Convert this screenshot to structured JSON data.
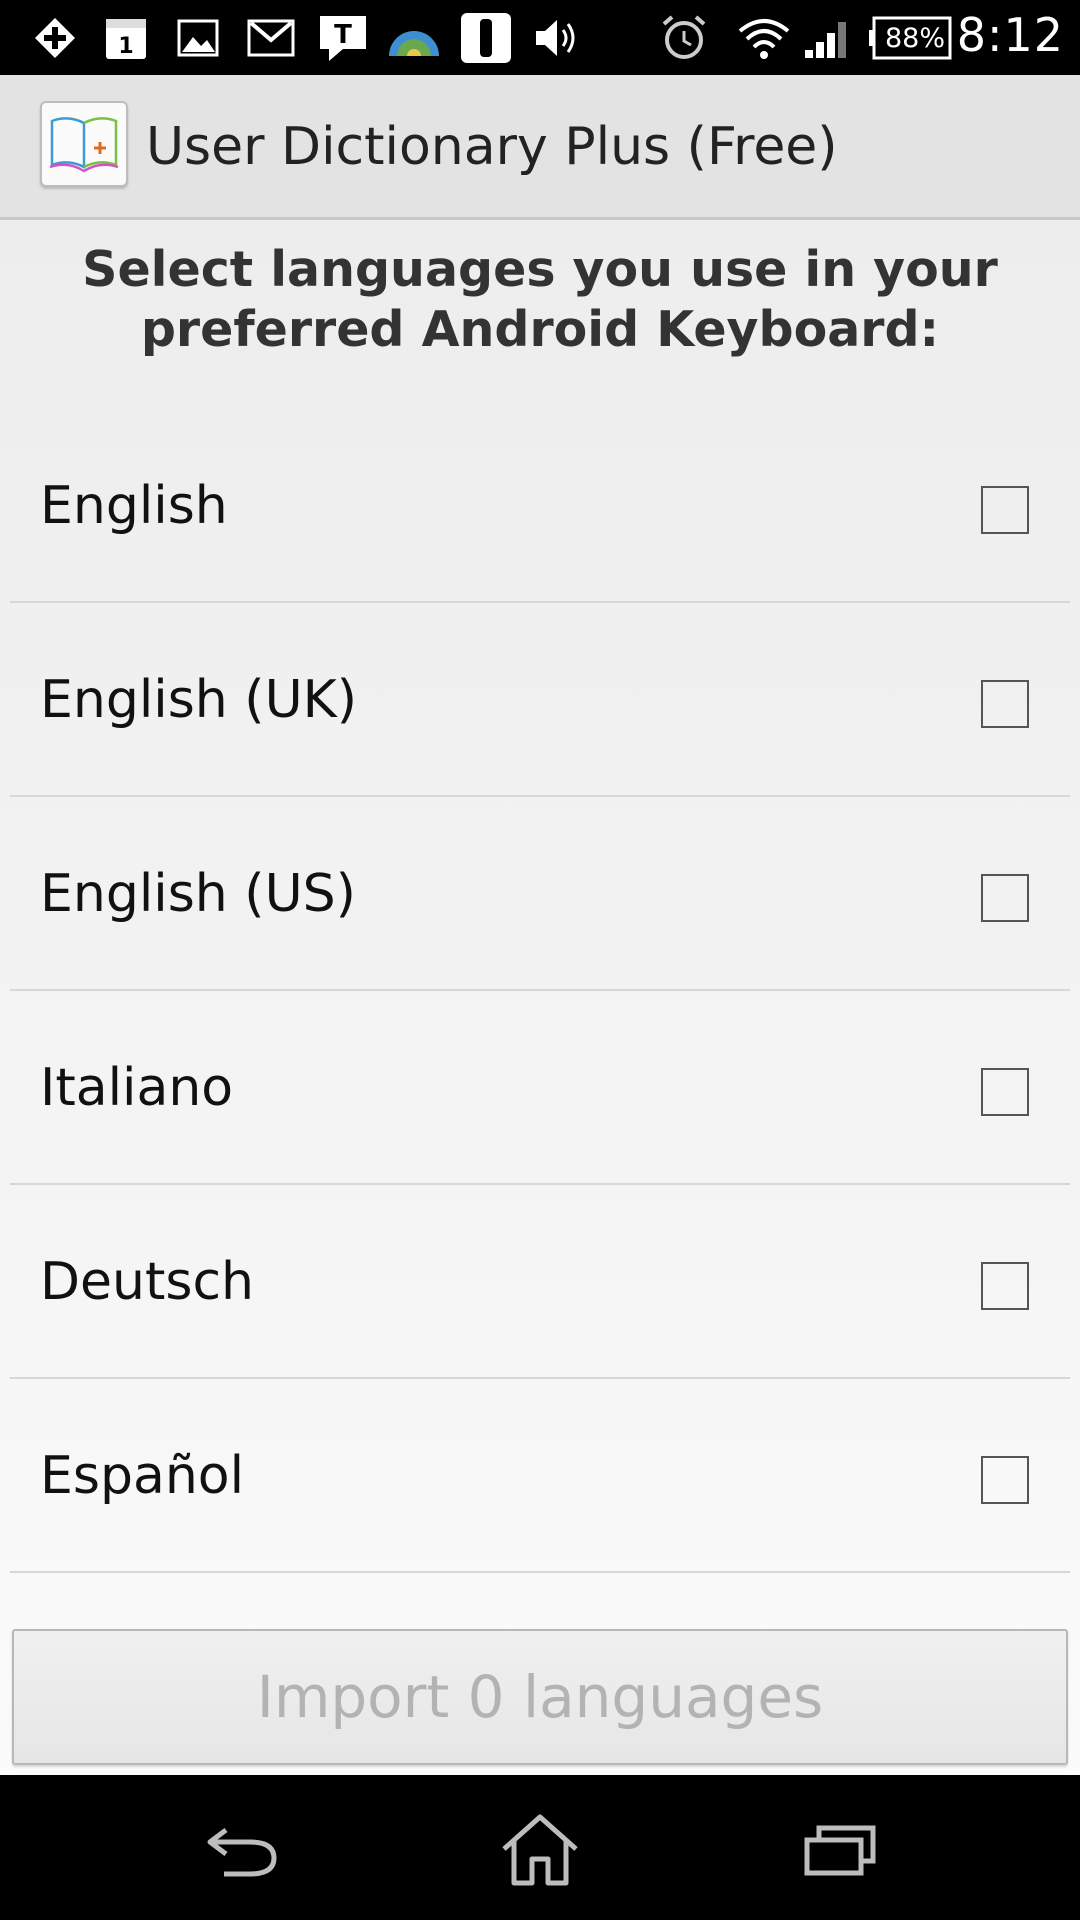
{
  "status_bar": {
    "time": "8:12",
    "battery": "88%",
    "icons": [
      "plus-notification-icon",
      "calendar-icon",
      "gallery-icon",
      "gmail-icon",
      "talk-icon",
      "globe-app-icon",
      "app-notification-icon",
      "volume-icon",
      "alarm-icon",
      "wifi-icon",
      "signal-icon",
      "battery-icon"
    ],
    "calendar_day": "1",
    "talk_letter": "T"
  },
  "action_bar": {
    "title": "User Dictionary Plus (Free)",
    "icon": "dictionary-book-icon"
  },
  "main": {
    "header": "Select languages you use in your preferred Android Keyboard:",
    "languages": [
      {
        "label": "English",
        "checked": false
      },
      {
        "label": "English (UK)",
        "checked": false
      },
      {
        "label": "English (US)",
        "checked": false
      },
      {
        "label": "Italiano",
        "checked": false
      },
      {
        "label": "Deutsch",
        "checked": false
      },
      {
        "label": "Español",
        "checked": false
      }
    ],
    "import_button": "Import 0 languages"
  },
  "nav_bar": {
    "buttons": [
      "back-icon",
      "home-icon",
      "recents-icon"
    ]
  }
}
